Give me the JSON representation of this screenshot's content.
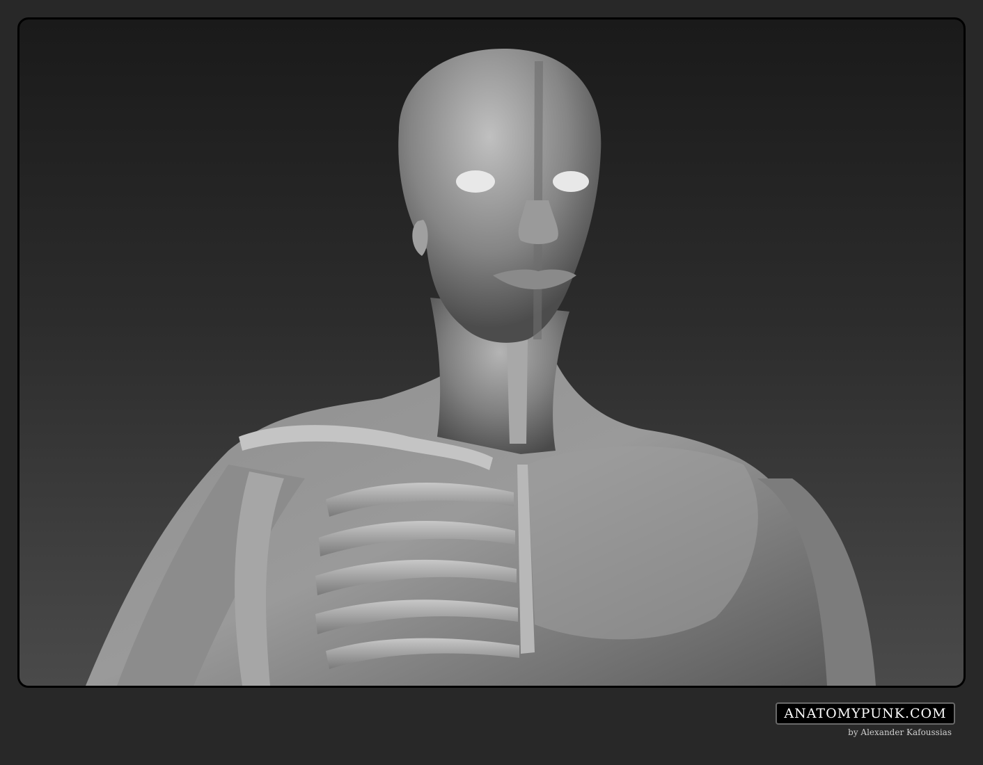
{
  "branding": {
    "site": "ANATOMYPUNK.COM",
    "byline": "by Alexander Kafoussias"
  },
  "artwork": {
    "subject": "anatomy-ecorche-bust-render",
    "colors": {
      "page_background": "#282828",
      "frame_border": "#000000",
      "model_grey": "#8a8a8a"
    }
  }
}
